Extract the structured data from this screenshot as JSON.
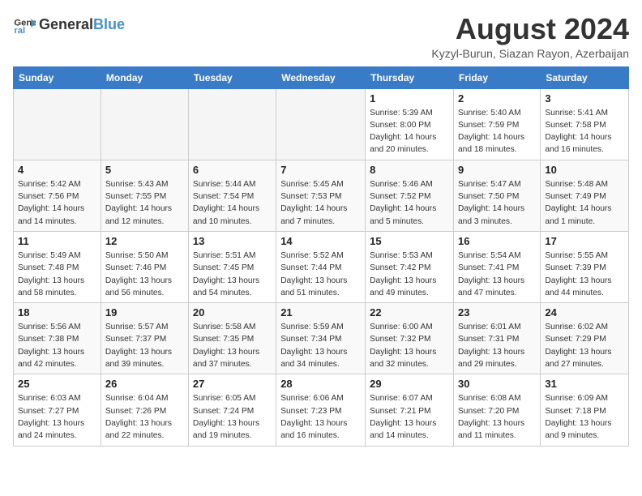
{
  "header": {
    "logo_general": "General",
    "logo_blue": "Blue",
    "month_year": "August 2024",
    "location": "Kyzyl-Burun, Siazan Rayon, Azerbaijan"
  },
  "weekdays": [
    "Sunday",
    "Monday",
    "Tuesday",
    "Wednesday",
    "Thursday",
    "Friday",
    "Saturday"
  ],
  "weeks": [
    [
      {
        "day": "",
        "info": ""
      },
      {
        "day": "",
        "info": ""
      },
      {
        "day": "",
        "info": ""
      },
      {
        "day": "",
        "info": ""
      },
      {
        "day": "1",
        "info": "Sunrise: 5:39 AM\nSunset: 8:00 PM\nDaylight: 14 hours\nand 20 minutes."
      },
      {
        "day": "2",
        "info": "Sunrise: 5:40 AM\nSunset: 7:59 PM\nDaylight: 14 hours\nand 18 minutes."
      },
      {
        "day": "3",
        "info": "Sunrise: 5:41 AM\nSunset: 7:58 PM\nDaylight: 14 hours\nand 16 minutes."
      }
    ],
    [
      {
        "day": "4",
        "info": "Sunrise: 5:42 AM\nSunset: 7:56 PM\nDaylight: 14 hours\nand 14 minutes."
      },
      {
        "day": "5",
        "info": "Sunrise: 5:43 AM\nSunset: 7:55 PM\nDaylight: 14 hours\nand 12 minutes."
      },
      {
        "day": "6",
        "info": "Sunrise: 5:44 AM\nSunset: 7:54 PM\nDaylight: 14 hours\nand 10 minutes."
      },
      {
        "day": "7",
        "info": "Sunrise: 5:45 AM\nSunset: 7:53 PM\nDaylight: 14 hours\nand 7 minutes."
      },
      {
        "day": "8",
        "info": "Sunrise: 5:46 AM\nSunset: 7:52 PM\nDaylight: 14 hours\nand 5 minutes."
      },
      {
        "day": "9",
        "info": "Sunrise: 5:47 AM\nSunset: 7:50 PM\nDaylight: 14 hours\nand 3 minutes."
      },
      {
        "day": "10",
        "info": "Sunrise: 5:48 AM\nSunset: 7:49 PM\nDaylight: 14 hours\nand 1 minute."
      }
    ],
    [
      {
        "day": "11",
        "info": "Sunrise: 5:49 AM\nSunset: 7:48 PM\nDaylight: 13 hours\nand 58 minutes."
      },
      {
        "day": "12",
        "info": "Sunrise: 5:50 AM\nSunset: 7:46 PM\nDaylight: 13 hours\nand 56 minutes."
      },
      {
        "day": "13",
        "info": "Sunrise: 5:51 AM\nSunset: 7:45 PM\nDaylight: 13 hours\nand 54 minutes."
      },
      {
        "day": "14",
        "info": "Sunrise: 5:52 AM\nSunset: 7:44 PM\nDaylight: 13 hours\nand 51 minutes."
      },
      {
        "day": "15",
        "info": "Sunrise: 5:53 AM\nSunset: 7:42 PM\nDaylight: 13 hours\nand 49 minutes."
      },
      {
        "day": "16",
        "info": "Sunrise: 5:54 AM\nSunset: 7:41 PM\nDaylight: 13 hours\nand 47 minutes."
      },
      {
        "day": "17",
        "info": "Sunrise: 5:55 AM\nSunset: 7:39 PM\nDaylight: 13 hours\nand 44 minutes."
      }
    ],
    [
      {
        "day": "18",
        "info": "Sunrise: 5:56 AM\nSunset: 7:38 PM\nDaylight: 13 hours\nand 42 minutes."
      },
      {
        "day": "19",
        "info": "Sunrise: 5:57 AM\nSunset: 7:37 PM\nDaylight: 13 hours\nand 39 minutes."
      },
      {
        "day": "20",
        "info": "Sunrise: 5:58 AM\nSunset: 7:35 PM\nDaylight: 13 hours\nand 37 minutes."
      },
      {
        "day": "21",
        "info": "Sunrise: 5:59 AM\nSunset: 7:34 PM\nDaylight: 13 hours\nand 34 minutes."
      },
      {
        "day": "22",
        "info": "Sunrise: 6:00 AM\nSunset: 7:32 PM\nDaylight: 13 hours\nand 32 minutes."
      },
      {
        "day": "23",
        "info": "Sunrise: 6:01 AM\nSunset: 7:31 PM\nDaylight: 13 hours\nand 29 minutes."
      },
      {
        "day": "24",
        "info": "Sunrise: 6:02 AM\nSunset: 7:29 PM\nDaylight: 13 hours\nand 27 minutes."
      }
    ],
    [
      {
        "day": "25",
        "info": "Sunrise: 6:03 AM\nSunset: 7:27 PM\nDaylight: 13 hours\nand 24 minutes."
      },
      {
        "day": "26",
        "info": "Sunrise: 6:04 AM\nSunset: 7:26 PM\nDaylight: 13 hours\nand 22 minutes."
      },
      {
        "day": "27",
        "info": "Sunrise: 6:05 AM\nSunset: 7:24 PM\nDaylight: 13 hours\nand 19 minutes."
      },
      {
        "day": "28",
        "info": "Sunrise: 6:06 AM\nSunset: 7:23 PM\nDaylight: 13 hours\nand 16 minutes."
      },
      {
        "day": "29",
        "info": "Sunrise: 6:07 AM\nSunset: 7:21 PM\nDaylight: 13 hours\nand 14 minutes."
      },
      {
        "day": "30",
        "info": "Sunrise: 6:08 AM\nSunset: 7:20 PM\nDaylight: 13 hours\nand 11 minutes."
      },
      {
        "day": "31",
        "info": "Sunrise: 6:09 AM\nSunset: 7:18 PM\nDaylight: 13 hours\nand 9 minutes."
      }
    ]
  ]
}
